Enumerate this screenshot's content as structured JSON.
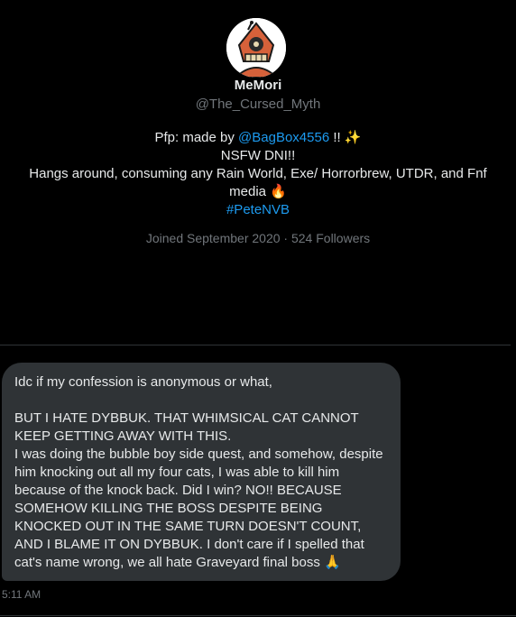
{
  "profile": {
    "display_name": "MeMori",
    "handle": "@The_Cursed_Myth",
    "bio": {
      "line1_prefix": "Pfp: made by ",
      "line1_mention": "@BagBox4556",
      "line1_suffix": " !! ✨",
      "line2": "NSFW DNI!!",
      "line3": "Hangs around, consuming any Rain World, Exe/ Horrorbrew, UTDR, and Fnf",
      "line4": "media 🔥",
      "hashtag": "#PeteNVB"
    },
    "joined": "Joined September 2020",
    "separator": "·",
    "followers": "524 Followers"
  },
  "message": {
    "paragraph1": "Idc if my confession is anonymous or what,",
    "paragraph2": "BUT I HATE DYBBUK. THAT WHIMSICAL CAT CANNOT KEEP GETTING AWAY WITH THIS.",
    "paragraph3": "I was doing the bubble boy side quest, and somehow, despite him knocking out all my four cats, I was able to kill him because of the knock back. Did I win? NO!! BECAUSE SOMEHOW KILLING THE BOSS DESPITE BEING KNOCKED OUT IN THE SAME TURN DOESN'T COUNT, AND I BLAME IT ON DYBBUK. I don't care if I spelled that cat's name wrong, we all hate Graveyard final boss 🙏",
    "timestamp": "5:11 AM"
  },
  "colors": {
    "background": "#000000",
    "bubble": "#2f3336",
    "link": "#1d9bf0",
    "muted": "#71767b",
    "text": "#e7e9ea"
  }
}
